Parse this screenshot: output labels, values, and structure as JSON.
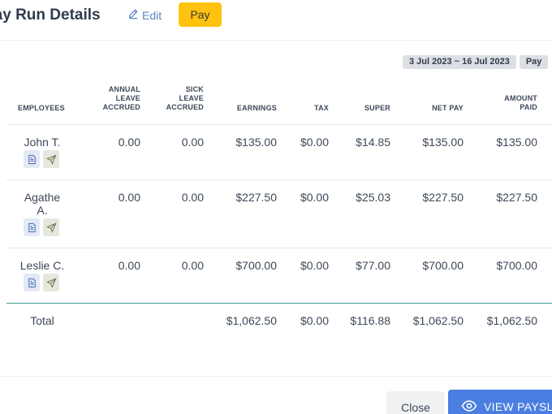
{
  "header": {
    "title": "Pay Run Details",
    "edit_label": "Edit",
    "pay_label": "Pay"
  },
  "badges": [
    "3 Jul 2023 ~ 16 Jul 2023",
    "Pay"
  ],
  "columns": {
    "employees": "EMPLOYEES",
    "annual_leave": [
      "ANNUAL",
      "LEAVE",
      "ACCRUED"
    ],
    "sick_leave": [
      "SICK",
      "LEAVE",
      "ACCRUED"
    ],
    "earnings": "EARNINGS",
    "tax": "TAX",
    "super": "SUPER",
    "net_pay": "NET PAY",
    "amount_paid": [
      "AMOUNT",
      "PAID"
    ]
  },
  "rows": [
    {
      "name": [
        "John T."
      ],
      "annual": "0.00",
      "sick": "0.00",
      "earnings": "$135.00",
      "tax": "$0.00",
      "super": "$14.85",
      "net": "$135.00",
      "paid": "$135.00"
    },
    {
      "name": [
        "Agathe",
        "A."
      ],
      "annual": "0.00",
      "sick": "0.00",
      "earnings": "$227.50",
      "tax": "$0.00",
      "super": "$25.03",
      "net": "$227.50",
      "paid": "$227.50"
    },
    {
      "name": [
        "Leslie C."
      ],
      "annual": "0.00",
      "sick": "0.00",
      "earnings": "$700.00",
      "tax": "$0.00",
      "super": "$77.00",
      "net": "$700.00",
      "paid": "$700.00"
    }
  ],
  "total": {
    "label": "Total",
    "earnings": "$1,062.50",
    "tax": "$0.00",
    "super": "$116.88",
    "net": "$1,062.50",
    "paid": "$1,062.50"
  },
  "footer": {
    "close_label": "Close",
    "view_label": "VIEW PAYSLIPS"
  },
  "colors": {
    "pay_button": "#ffc20e",
    "view_button": "#4a7ee0",
    "total_separator": "#3f9e94",
    "edit_link": "#5b86c5"
  },
  "icons": [
    "pencil-icon",
    "document-icon",
    "send-icon",
    "eye-icon"
  ]
}
